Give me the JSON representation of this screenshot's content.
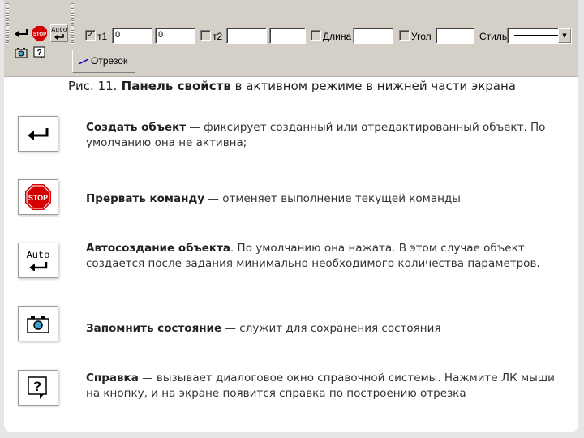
{
  "toolbar": {
    "t1_label": "т1",
    "t1_x": "0",
    "t1_y": "0",
    "t2_label": "т2",
    "length_label": "Длина",
    "angle_label": "Угол",
    "style_label": "Стиль",
    "tab_label": "Отрезок",
    "auto_label": "Auto",
    "stop_label": "STOP"
  },
  "caption": {
    "prefix": "Рис. 11.",
    "bold": " Панель свойств",
    "rest": " в активном режиме в нижней части экрана"
  },
  "items": [
    {
      "icon": "create-object-icon",
      "title": "Создать объект",
      "text": " — фиксирует созданный или отредактированный объект. По умолчанию она не активна;"
    },
    {
      "icon": "stop-icon",
      "title": "Прервать команду",
      "text": " — отменяет выполнение текущей команды",
      "badge": "STOP"
    },
    {
      "icon": "auto-create-icon",
      "title": "Автосоздание объекта",
      "text": ". По умолчанию она нажата. В этом случае объект создается после задания минимально необходимого количества параметров.",
      "badge": "Auto"
    },
    {
      "icon": "camera-icon",
      "title": "Запомнить состояние",
      "text": " — служит для сохранения состояния"
    },
    {
      "icon": "help-icon",
      "title": "Справка",
      "text": " — вызывает диалоговое окно справочной системы. Нажмите ЛК мыши на кнопку, и на экране появится справка по построению отрезка",
      "badge": "?"
    }
  ]
}
